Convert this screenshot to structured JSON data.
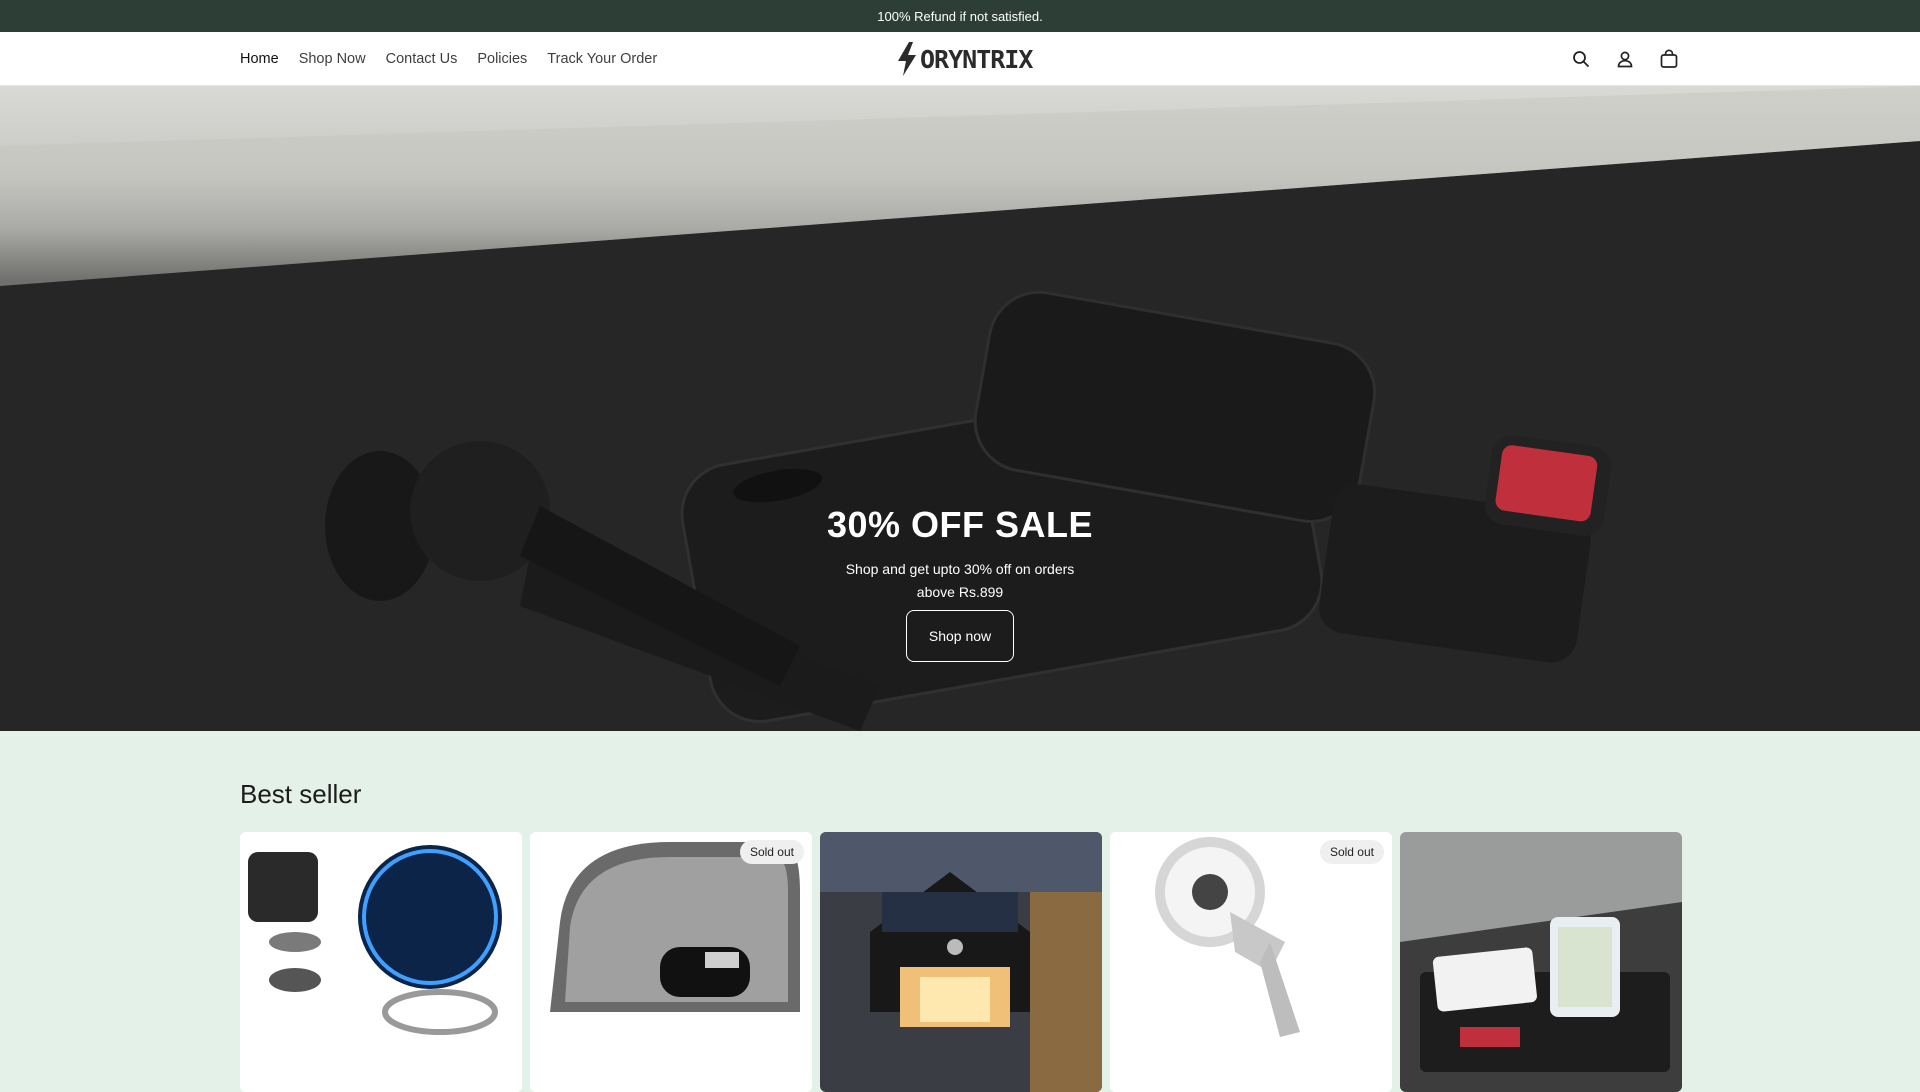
{
  "announcement": {
    "text": "100% Refund if not satisfied."
  },
  "nav": {
    "items": [
      {
        "label": "Home"
      },
      {
        "label": "Shop Now"
      },
      {
        "label": "Contact Us"
      },
      {
        "label": "Policies"
      },
      {
        "label": "Track Your Order"
      }
    ]
  },
  "brand": {
    "name": "ORYNTRIX"
  },
  "header_icons": [
    "search-icon",
    "account-icon",
    "cart-icon"
  ],
  "hero": {
    "title": "30% OFF SALE",
    "subtitle": "Shop and get upto 30% off on orders above Rs.899",
    "button_label": "Shop now"
  },
  "bestseller": {
    "title": "Best seller",
    "products": [
      {
        "badge": ""
      },
      {
        "badge": "Sold out"
      },
      {
        "badge": ""
      },
      {
        "badge": "Sold out"
      },
      {
        "badge": ""
      }
    ]
  },
  "colors": {
    "announcement_bg": "#2c3e35",
    "section_bg": "#e3f1e8",
    "hero_bg": "#2b2b2b"
  }
}
